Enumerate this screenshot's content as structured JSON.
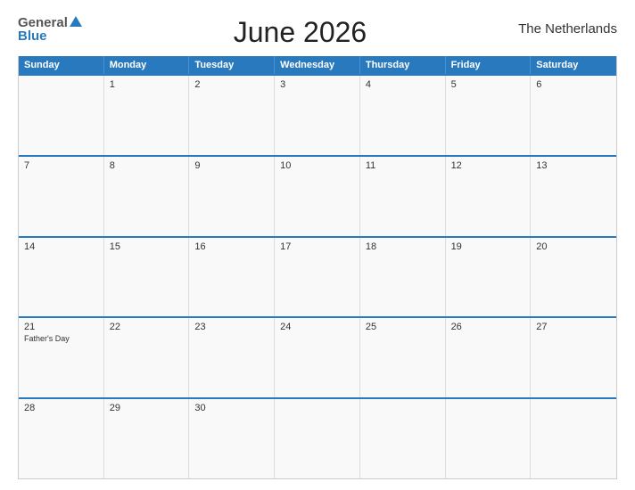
{
  "header": {
    "title": "June 2026",
    "country": "The Netherlands"
  },
  "logo": {
    "general": "General",
    "blue": "Blue"
  },
  "days": {
    "headers": [
      "Sunday",
      "Monday",
      "Tuesday",
      "Wednesday",
      "Thursday",
      "Friday",
      "Saturday"
    ]
  },
  "weeks": [
    [
      {
        "num": "",
        "event": ""
      },
      {
        "num": "1",
        "event": ""
      },
      {
        "num": "2",
        "event": ""
      },
      {
        "num": "3",
        "event": ""
      },
      {
        "num": "4",
        "event": ""
      },
      {
        "num": "5",
        "event": ""
      },
      {
        "num": "6",
        "event": ""
      }
    ],
    [
      {
        "num": "7",
        "event": ""
      },
      {
        "num": "8",
        "event": ""
      },
      {
        "num": "9",
        "event": ""
      },
      {
        "num": "10",
        "event": ""
      },
      {
        "num": "11",
        "event": ""
      },
      {
        "num": "12",
        "event": ""
      },
      {
        "num": "13",
        "event": ""
      }
    ],
    [
      {
        "num": "14",
        "event": ""
      },
      {
        "num": "15",
        "event": ""
      },
      {
        "num": "16",
        "event": ""
      },
      {
        "num": "17",
        "event": ""
      },
      {
        "num": "18",
        "event": ""
      },
      {
        "num": "19",
        "event": ""
      },
      {
        "num": "20",
        "event": ""
      }
    ],
    [
      {
        "num": "21",
        "event": "Father's Day"
      },
      {
        "num": "22",
        "event": ""
      },
      {
        "num": "23",
        "event": ""
      },
      {
        "num": "24",
        "event": ""
      },
      {
        "num": "25",
        "event": ""
      },
      {
        "num": "26",
        "event": ""
      },
      {
        "num": "27",
        "event": ""
      }
    ],
    [
      {
        "num": "28",
        "event": ""
      },
      {
        "num": "29",
        "event": ""
      },
      {
        "num": "30",
        "event": ""
      },
      {
        "num": "",
        "event": ""
      },
      {
        "num": "",
        "event": ""
      },
      {
        "num": "",
        "event": ""
      },
      {
        "num": "",
        "event": ""
      }
    ]
  ]
}
